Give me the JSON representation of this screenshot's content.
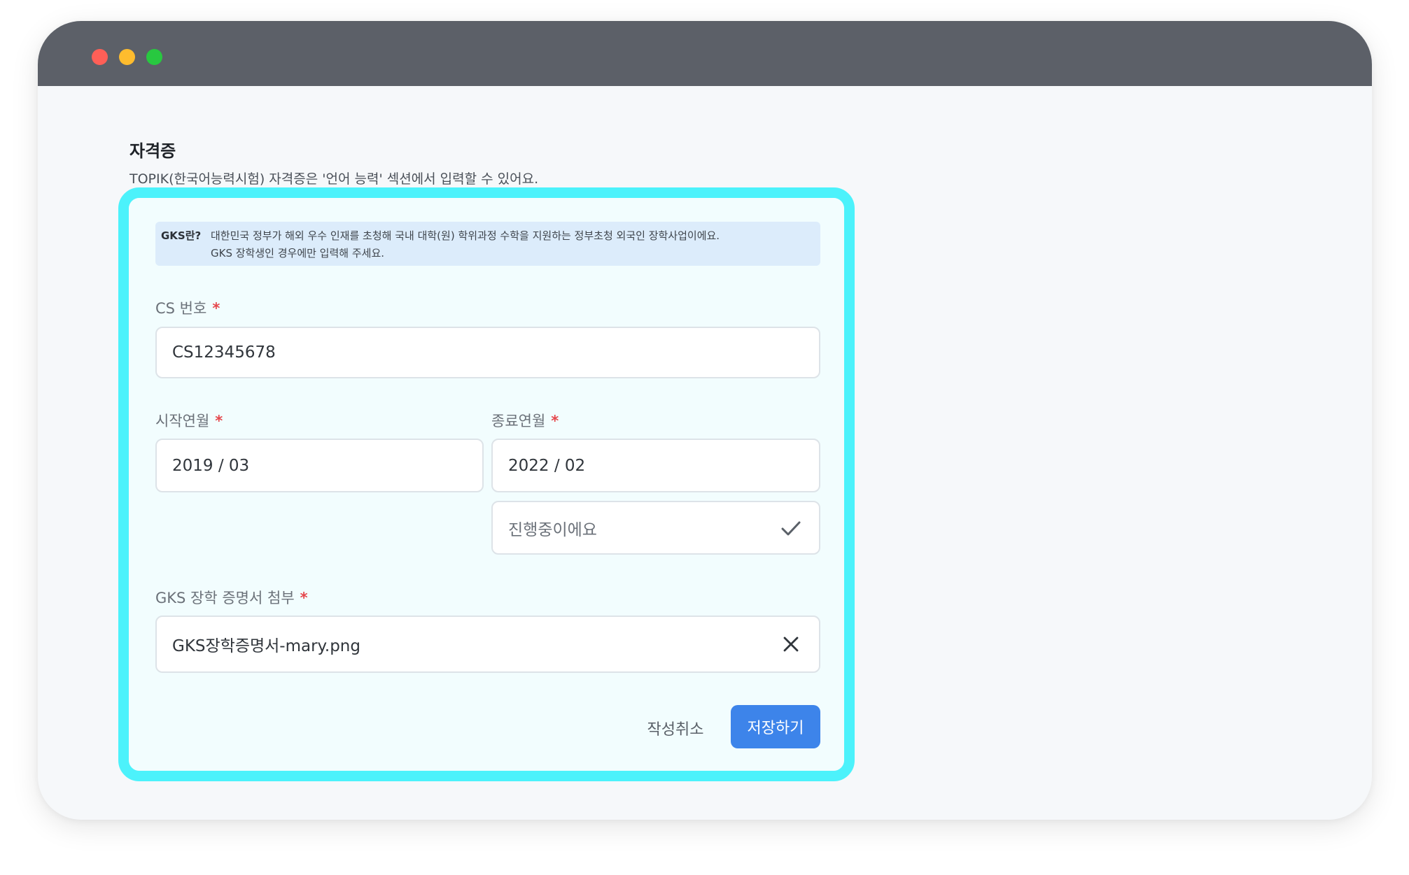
{
  "colors": {
    "titlebar": "#5c6068",
    "traffic_red": "#ff5f57",
    "traffic_yellow": "#febc2e",
    "traffic_green": "#28c840",
    "highlight": "#4cf2fb",
    "primary": "#3d84ea",
    "required": "#e5484d"
  },
  "section": {
    "title": "자격증",
    "description": "TOPIK(한국어능력시험) 자격증은 '언어 능력' 섹션에서 입력할 수 있어요."
  },
  "notice": {
    "tag": "GKS란?",
    "line1": "대한민국 정부가 해외 우수 인재를 초청해 국내 대학(원) 학위과정 수학을 지원하는 정부초청 외국인 장학사업이에요.",
    "line2": "GKS 장학생인 경우에만 입력해 주세요."
  },
  "form": {
    "required_mark": "*",
    "cs_number": {
      "label": "CS 번호",
      "value": "CS12345678"
    },
    "start_date": {
      "label": "시작연월",
      "value": "2019  / 03"
    },
    "end_date": {
      "label": "종료연월",
      "value": "2022  / 02"
    },
    "in_progress": {
      "label": "진행중이에요",
      "icon": "check-icon"
    },
    "attachment": {
      "label": "GKS 장학 증명서 첨부",
      "file_name": "GKS장학증명서-mary.png",
      "icon": "close-icon"
    }
  },
  "actions": {
    "cancel_label": "작성취소",
    "save_label": "저장하기"
  }
}
